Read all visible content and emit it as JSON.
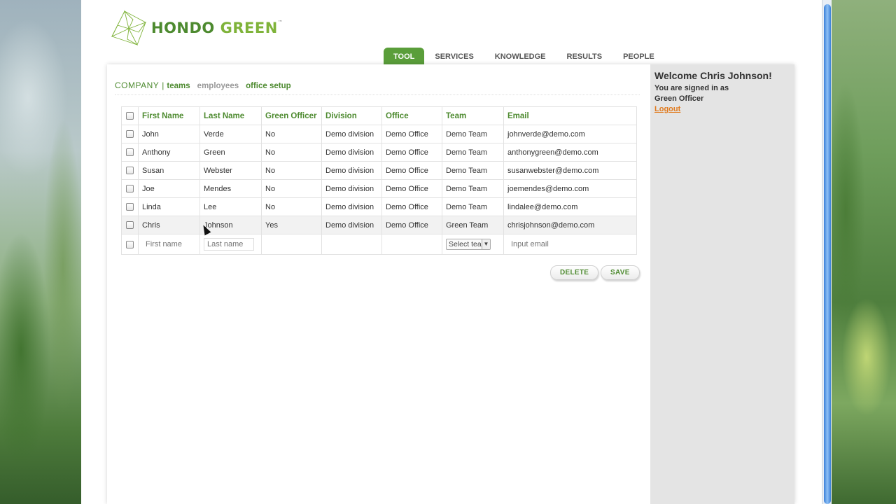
{
  "brand": {
    "name_part1": "HONDO",
    "name_part2": "GREEN",
    "trademark": "™"
  },
  "topnav": {
    "tabs": [
      {
        "label": "TOOL",
        "active": true
      },
      {
        "label": "SERVICES",
        "active": false
      },
      {
        "label": "KNOWLEDGE",
        "active": false
      },
      {
        "label": "RESULTS",
        "active": false
      },
      {
        "label": "PEOPLE",
        "active": false
      }
    ]
  },
  "subnav": {
    "section": "COMPANY",
    "separator": "|",
    "links": [
      "teams",
      "employees",
      "office setup"
    ]
  },
  "sidebar": {
    "welcome": "Welcome Chris Johnson!",
    "signed_in_line": "You are signed in as",
    "role": "Green Officer",
    "logout": "Logout"
  },
  "table": {
    "columns": [
      "First Name",
      "Last Name",
      "Green Officer",
      "Division",
      "Office",
      "Team",
      "Email"
    ],
    "rows": [
      [
        "John",
        "Verde",
        "No",
        "Demo division",
        "Demo Office",
        "Demo Team",
        "johnverde@demo.com"
      ],
      [
        "Anthony",
        "Green",
        "No",
        "Demo division",
        "Demo Office",
        "Demo Team",
        "anthonygreen@demo.com"
      ],
      [
        "Susan",
        "Webster",
        "No",
        "Demo division",
        "Demo Office",
        "Demo Team",
        "susanwebster@demo.com"
      ],
      [
        "Joe",
        "Mendes",
        "No",
        "Demo division",
        "Demo Office",
        "Demo Team",
        "joemendes@demo.com"
      ],
      [
        "Linda",
        "Lee",
        "No",
        "Demo division",
        "Demo Office",
        "Demo Team",
        "lindalee@demo.com"
      ],
      [
        "Chris",
        "Johnson",
        "Yes",
        "Demo division",
        "Demo Office",
        "Green Team",
        "chrisjohnson@demo.com"
      ]
    ],
    "new_row": {
      "first_name_placeholder": "First name",
      "last_name_placeholder": "Last name",
      "team_select": "Select team",
      "email_placeholder": "Input email"
    }
  },
  "actions": {
    "delete": "DELETE",
    "save": "SAVE"
  },
  "colors": {
    "brand_green": "#4d8a2f",
    "active_tab": "#5a9e3a",
    "logout": "#e07a1e"
  }
}
